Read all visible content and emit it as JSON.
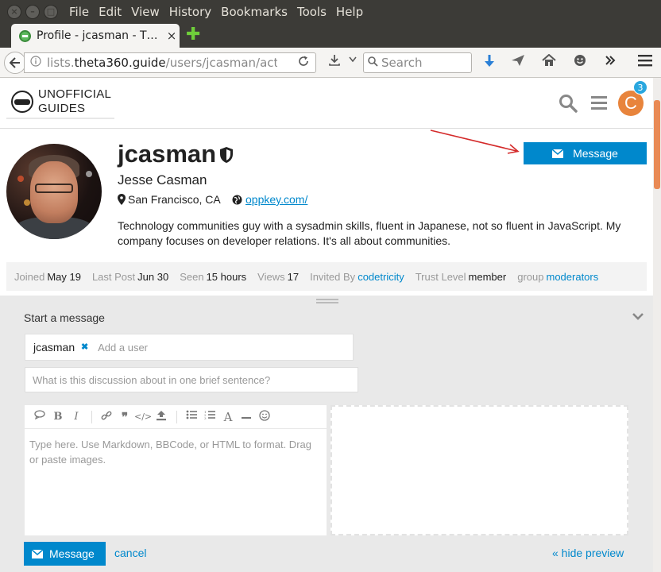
{
  "window": {
    "menu": [
      "File",
      "Edit",
      "View",
      "History",
      "Bookmarks",
      "Tools",
      "Help"
    ],
    "win_buttons": [
      "×",
      "–",
      "□"
    ]
  },
  "tab": {
    "title": "Profile - jcasman - T…",
    "close": "×",
    "new_tab": "✚"
  },
  "nav": {
    "url_prefix": "lists.",
    "url_domain": "theta360.guide",
    "url_path": "/users/jcasman/acti",
    "search_placeholder": "Search"
  },
  "site": {
    "logo_line1": "UNOFFICIAL",
    "logo_line2": "GUIDES",
    "avatar_letter": "C",
    "notification_count": "3"
  },
  "profile": {
    "username": "jcasman",
    "full_name": "Jesse Casman",
    "location": "San Francisco, CA",
    "website": "oppkey.com/",
    "bio": "Technology communities guy with a sysadmin skills, fluent in Japanese, not so fluent in JavaScript. My company focuses on developer relations. It's all about communities.",
    "message_button": "Message"
  },
  "stats": [
    {
      "label": "Joined",
      "value": "May 19",
      "kind": "val"
    },
    {
      "label": "Last Post",
      "value": "Jun 30",
      "kind": "val"
    },
    {
      "label": "Seen",
      "value": "15 hours",
      "kind": "val"
    },
    {
      "label": "Views",
      "value": "17",
      "kind": "val"
    },
    {
      "label": "Invited By",
      "value": "codetricity",
      "kind": "lnk"
    },
    {
      "label": "Trust Level",
      "value": "member",
      "kind": "val"
    },
    {
      "label": "group",
      "value": "moderators",
      "kind": "lnk"
    }
  ],
  "composer": {
    "title": "Start a message",
    "recipient": "jcasman",
    "add_user_placeholder": "Add a user",
    "topic_placeholder": "What is this discussion about in one brief sentence?",
    "editor_placeholder": "Type here. Use Markdown, BBCode, or HTML to format. Drag or paste images.",
    "send_label": "Message",
    "cancel_label": "cancel",
    "hide_preview_label": "« hide preview"
  },
  "colors": {
    "accent": "#0088cc",
    "avatar_orange": "#e8843c",
    "notification_blue": "#29a7df",
    "annotation_arrow": "#d42a2a"
  }
}
